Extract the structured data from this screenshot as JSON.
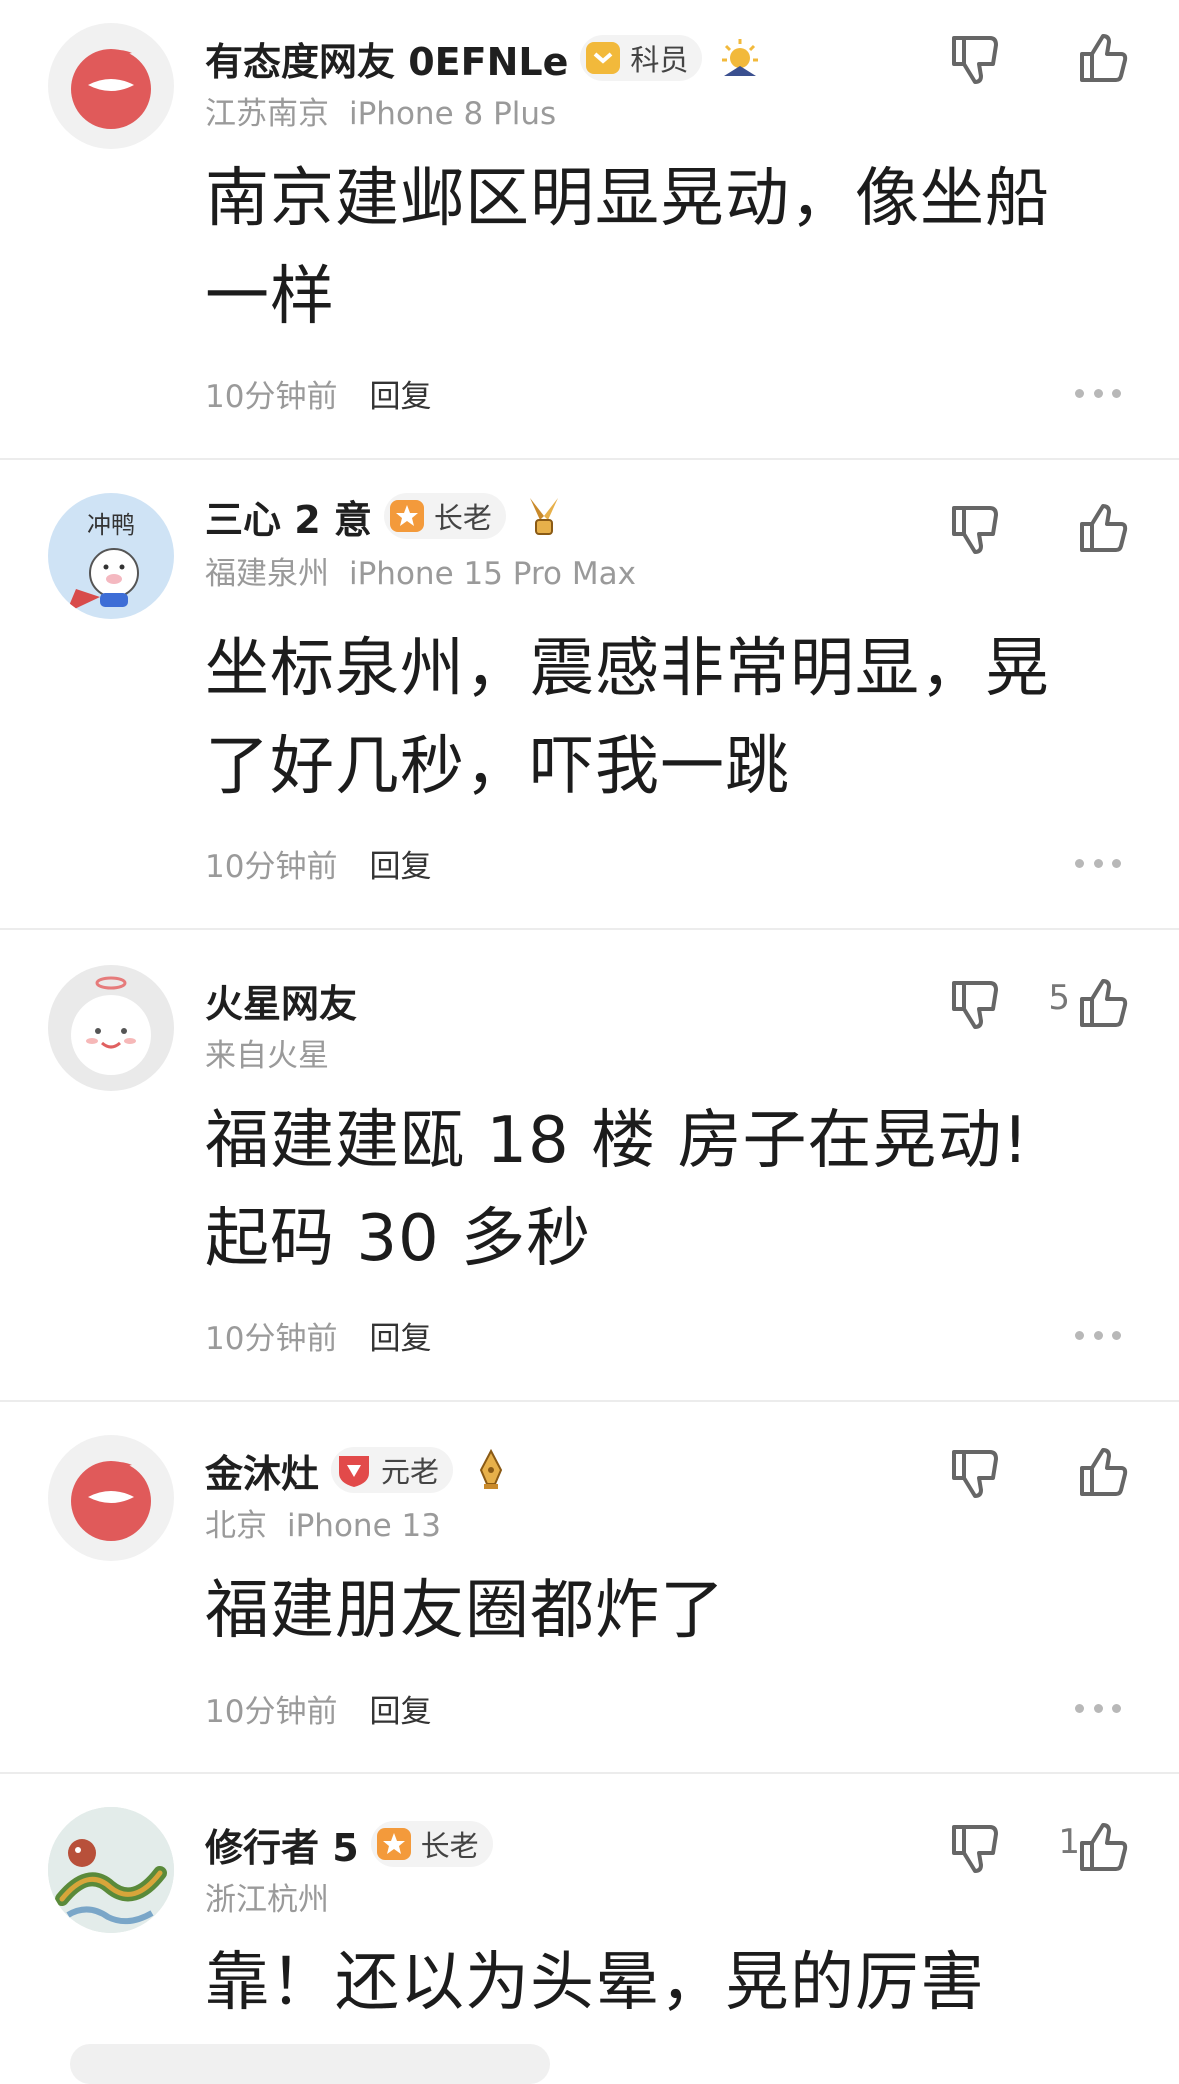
{
  "comments": [
    {
      "username": "有态度网友 0EFNLe",
      "badge": "科员",
      "location": "江苏南京",
      "device": "iPhone 8 Plus",
      "text_lines": [
        "南京建邺区明显晃动，像坐船",
        "一样"
      ],
      "time": "10分钟前",
      "reply": "回复",
      "likes": ""
    },
    {
      "username": "三心 2 意",
      "badge": "长老",
      "location": "福建泉州",
      "device": "iPhone 15 Pro Max",
      "text_lines": [
        "坐标泉州，震感非常明显，晃",
        "了好几秒，吓我一跳"
      ],
      "time": "10分钟前",
      "reply": "回复",
      "likes": ""
    },
    {
      "username": "火星网友",
      "location": "来自火星",
      "text_lines": [
        "福建建瓯 18 楼 房子在晃动!",
        "起码 30 多秒"
      ],
      "time": "10分钟前",
      "reply": "回复",
      "likes": "5"
    },
    {
      "username": "金沐灶",
      "badge": "元老",
      "location": "北京",
      "device": "iPhone 13",
      "text_lines": [
        "福建朋友圈都炸了"
      ],
      "time": "10分钟前",
      "reply": "回复",
      "likes": ""
    },
    {
      "username": "修行者 5",
      "badge": "长老",
      "location": "浙江杭州",
      "text_lines": [
        "靠！还以为头晕，晃的厉害"
      ],
      "likes": "1"
    }
  ],
  "colors": {
    "badge_gold": "#f2b93b",
    "badge_orange": "#f39a3b",
    "badge_red": "#e24a4a",
    "brand_red": "#e05a5a"
  }
}
